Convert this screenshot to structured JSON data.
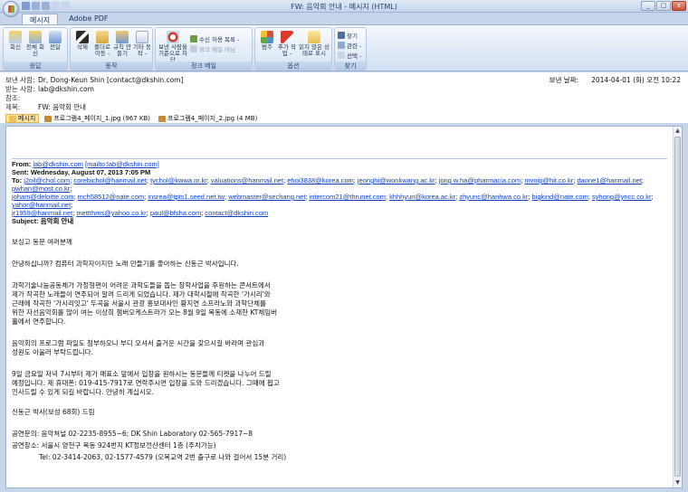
{
  "window": {
    "title": "FW: 음악회 안내 - 메시지 (HTML)",
    "tabs": [
      "메시지",
      "Adobe PDF"
    ],
    "controls": [
      "_",
      "□",
      "x"
    ]
  },
  "ribbon": {
    "groups": [
      {
        "label": "응답",
        "buttons": [
          "회신",
          "전체 회신",
          "전달"
        ]
      },
      {
        "label": "동작",
        "buttons": [
          "삭제",
          "폴더로 이동 -",
          "규칙 만들기",
          "기타 동작 -"
        ]
      },
      {
        "label": "정크 메일",
        "buttons": [
          "보낸 사람을 기준으로 차단"
        ],
        "small": [
          "수신 허용 목록 -",
          "정크 메일 아님"
        ]
      },
      {
        "label": "옵션",
        "buttons": [
          "범주",
          "추가 작업 -",
          "읽지 않은 상태로 표시"
        ]
      },
      {
        "label": "찾기",
        "small": [
          "찾기",
          "관련 -",
          "선택 -"
        ]
      }
    ]
  },
  "header": {
    "from_label": "보낸 사람:",
    "from_value": "Dr, Dong-Keun Shin [contact@dkshin.com]",
    "to_label": "받는 사람:",
    "to_value": "lab@dkshin.com",
    "cc_label": "참조:",
    "subject_label": "제목:",
    "subject_value": "FW: 음악회 안내",
    "date_label": "보낸 날짜:",
    "date_value": "2014-04-01 (화) 오전 10:22"
  },
  "attachments": [
    {
      "name": "메시지",
      "selected": true
    },
    {
      "name": "프로그램4_페이지_1.jpg (967 KB)",
      "selected": false
    },
    {
      "name": "프로그램4_페이지_2.jpg (4 MB)",
      "selected": false
    }
  ],
  "forward": {
    "from_label": "From:",
    "from_email": "lab@dkshin.com",
    "from_mailto": "[mailto:lab@dkshin.com]",
    "sent_label": "Sent:",
    "sent_value": "Wednesday, August 07, 2013 7:05 PM",
    "to_label": "To:",
    "recipients_line1": [
      "j2oil@chol.com",
      "corebichol@hanmail.net",
      "tychol@kwwa.or.kr",
      "valuations@hanmail.net",
      "ehoi3838@korea.com",
      "jeonghi@wonkwang.ac.kr",
      "jong.w.ha@pharmacia.com",
      "mvoip@hit.co.kr",
      "daone1@hanmail.net",
      "pwhan@most.co.kr"
    ],
    "recipients_line2": [
      "joham@deloitte.com",
      "mch58512@nate.com",
      "insrea@tpts1.seed.net.tw",
      "webmaster@sechang.net",
      "intercom21@thrunet.com",
      "khhhyun@korea.ac.kr",
      "zhyunc@hanhwa.co.kr",
      "bigkind@nate.com",
      "syhong@yncc.co.kr",
      "yahor@hanmail.net"
    ],
    "recipients_line3": [
      "jr1959@hanmail.net",
      "mettthms@yahoo.co.kr",
      "paul@bfsha.com",
      "contact@dkshin.com"
    ],
    "subject_label": "Subject:",
    "subject_value": "음악회 안내"
  },
  "body": {
    "greeting": "보싱고 동문 여러분께",
    "intro": "안녕하십니까? 컴퓨터 과학자이지만 노래 만들기를 좋아하는 신동근 박사입니다.",
    "p1": [
      "과학기술나눔공동체가 가정형편이 어려운 과학도들을 돕는 장학사업을 후원하는 콘서트에서",
      "제가 작곡한 노래들이 연주되어 알려 드리게 되었습니다. 제가 대학시절에 작곡한 '가시리'와",
      "근래에 작곡한 '가시리잇고' 두곡을 서울시 관광 홍보대사인 황지연 소프라노와 과학단체를",
      "위한 자선음악회를 많이 여는 이상희 챔버오케스트라가 오는 8월 9일 목동에 소재한 KT체임버",
      "홀에서 연주합니다."
    ],
    "p2": [
      "음악회의 프로그램 파일도 첨부하오니 부디 오셔서 즐거운 시간을 갖으시길 바라며 관심과",
      "성원도 아울러 부탁드립니다."
    ],
    "p3": [
      "9일 금요일 저녁 7시부터 제가 매표소 앞에서 입장을 원하시는 동문들께 티켓을 나누어 드릴",
      "예정입니다. 제 휴대폰: 019-415-7917로 연락주시면 입장을 도와 드리겠습니다. 그때에 뵙고",
      "인사드릴 수 있게 되길 바랍니다. 안녕히 계십시오."
    ],
    "signature": "신동근 박사(보성 68회) 드림",
    "contact1": "공연문의: 음악쳐널 02-2235-8955~6; DK Shin Laboratory 02-565-7917~8",
    "contact2": "공연장소: 서울시 양천구 목동 924번지 KT정보전산센터 1층  (주차가능)",
    "contact3": "Tel: 02-3414-2063, 02-1577-4579 (오목교역 2번 출구로 나와 걸어서 15분 거리)"
  }
}
